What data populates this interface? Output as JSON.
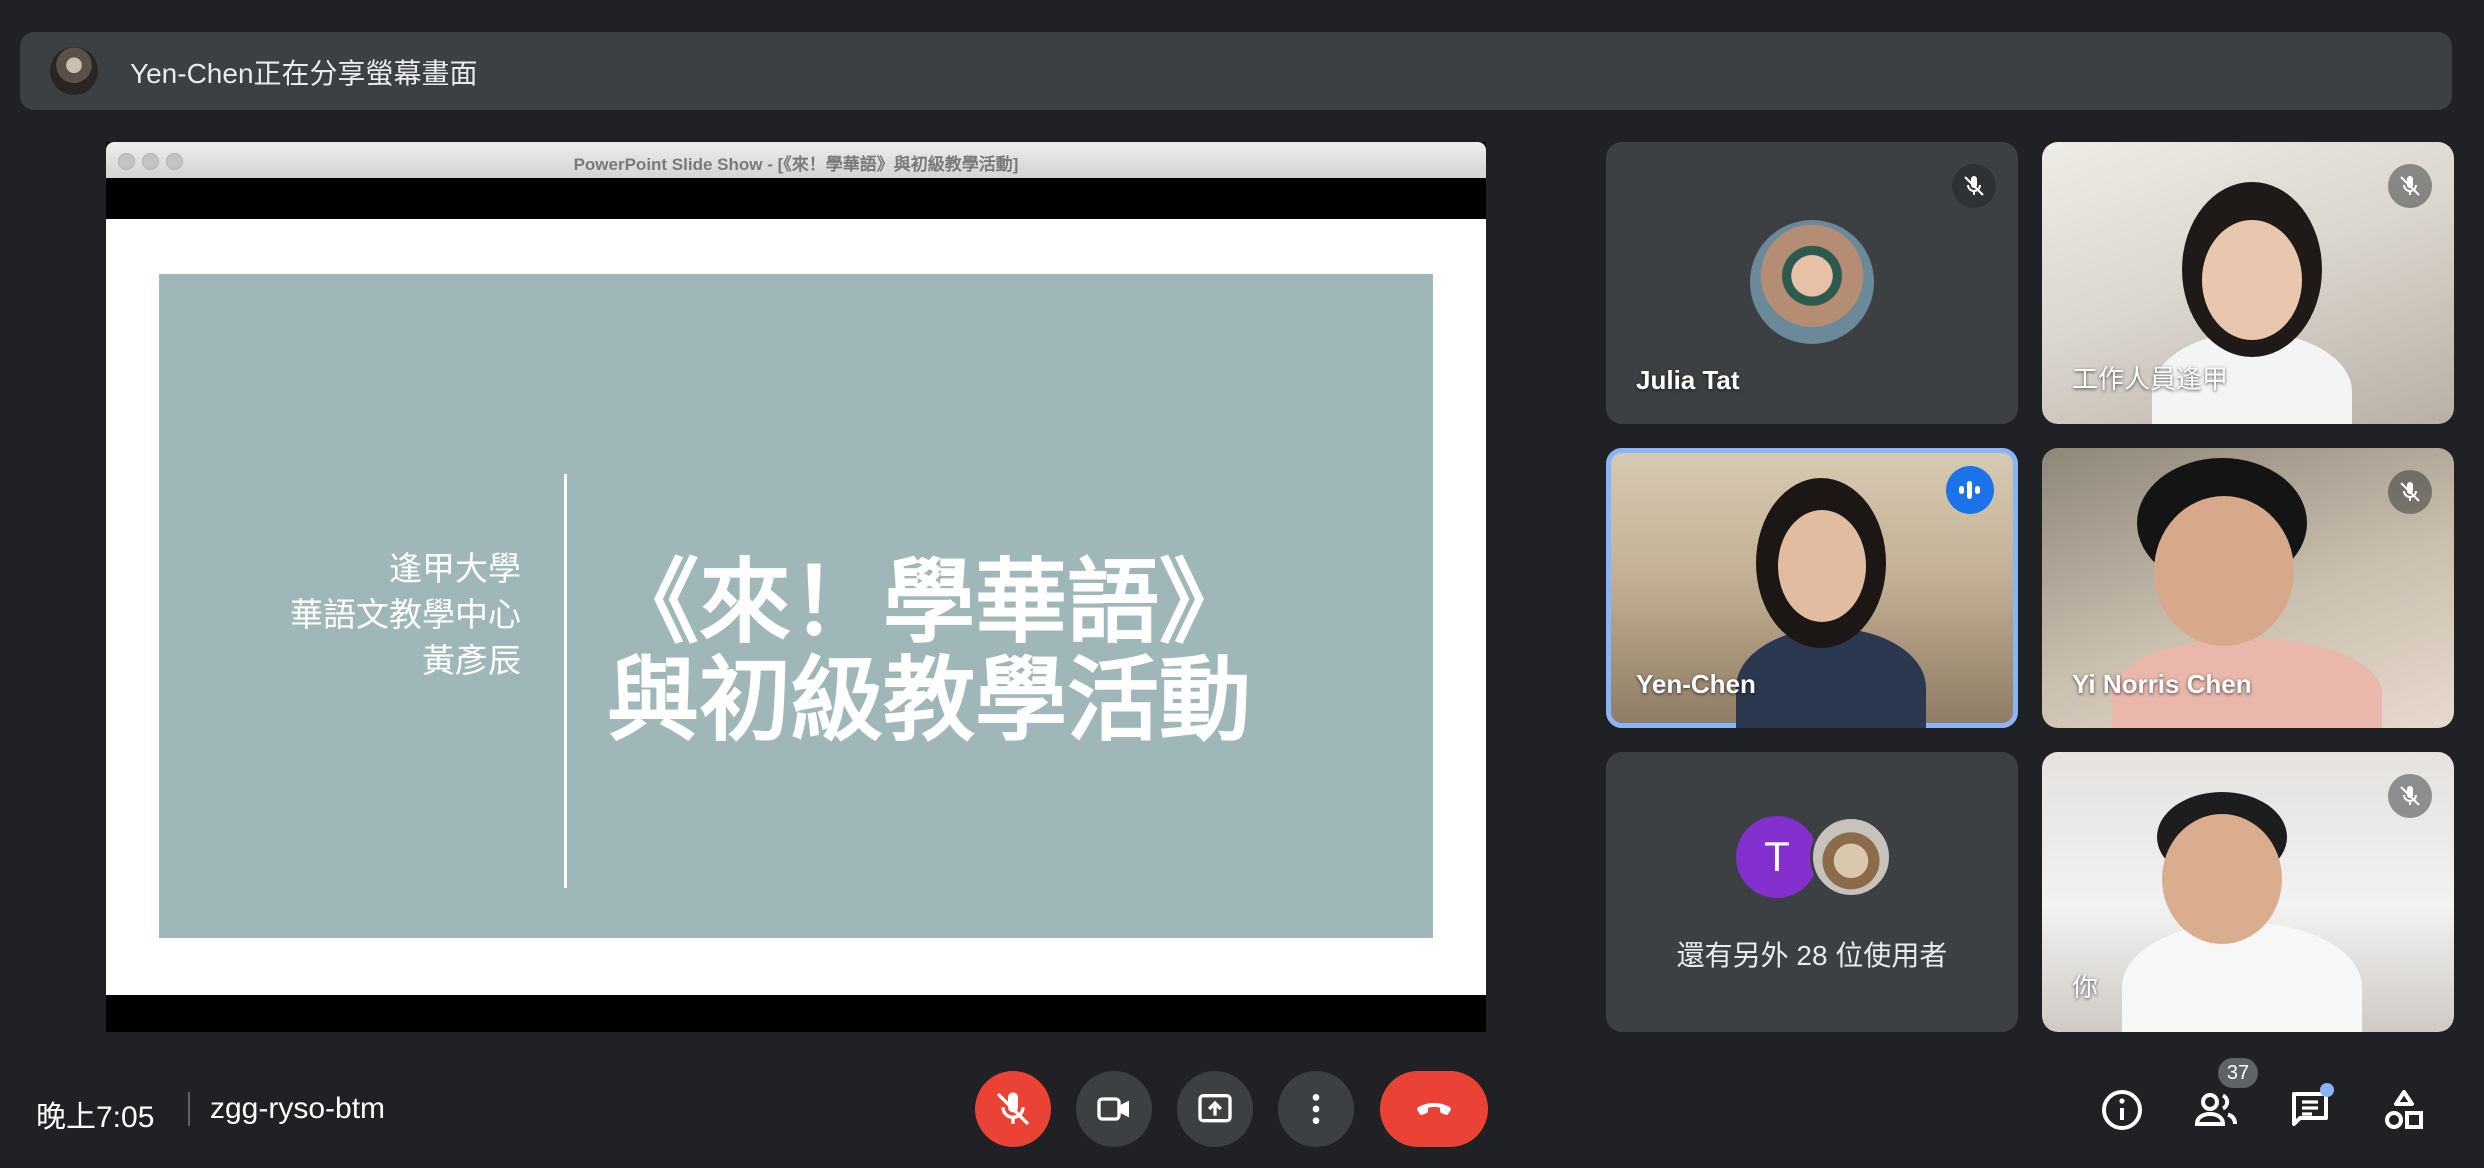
{
  "banner": {
    "text": "Yen-Chen正在分享螢幕畫面"
  },
  "presentation": {
    "window_title": "PowerPoint Slide Show - [《來！學華語》與初級教學活動]",
    "slide": {
      "left_lines": [
        "逢甲大學",
        "華語文教學中心",
        "黃彥辰"
      ],
      "title_lines": [
        "《來！學華語》",
        "與初級教學活動"
      ]
    }
  },
  "participants": [
    {
      "name": "Julia Tat",
      "muted": true,
      "speaking": false
    },
    {
      "name": "工作人員逢甲",
      "muted": true,
      "speaking": false
    },
    {
      "name": "Yen-Chen",
      "muted": false,
      "speaking": true
    },
    {
      "name": "Yi Norris Chen",
      "muted": true,
      "speaking": false
    },
    {
      "name": "你",
      "muted": true,
      "speaking": false
    }
  ],
  "others": {
    "avatar_letter": "T",
    "text": "還有另外 28 位使用者"
  },
  "bottom_bar": {
    "time": "晚上7:05",
    "meeting_code": "zgg-ryso-btm",
    "people_count": "37"
  },
  "colors": {
    "background": "#202124",
    "tile": "#3c4043",
    "danger": "#ea4335",
    "speaking": "#1a73e8",
    "slide_panel": "#a0b7ba"
  },
  "icons": [
    "mic-off-icon",
    "camera-icon",
    "present-icon",
    "more-vert-icon",
    "call-end-icon",
    "info-icon",
    "people-icon",
    "chat-icon",
    "activities-icon"
  ]
}
